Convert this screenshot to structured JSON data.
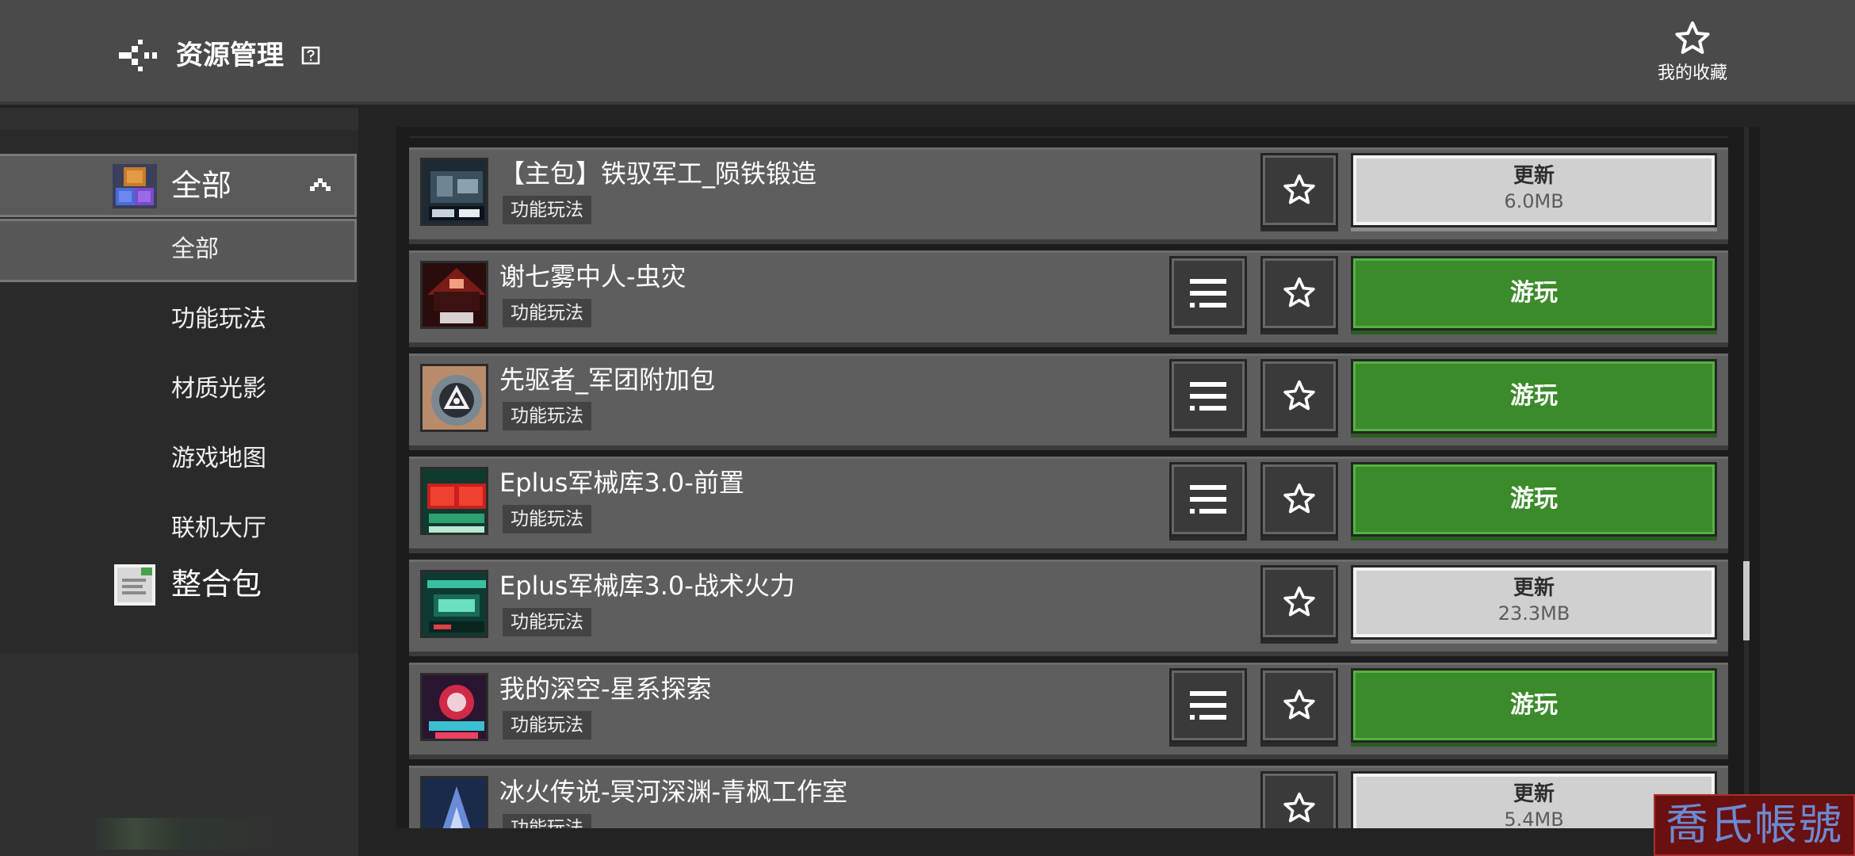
{
  "header": {
    "title": "资源管理",
    "help_icon": "help-icon",
    "back_icon": "back-arrow-icon",
    "favorites_label": "我的收藏",
    "favorites_icon": "star-outline-icon"
  },
  "sidebar": {
    "category": {
      "label": "全部",
      "icon": "blocks-icon",
      "expanded": true
    },
    "sub_items": [
      {
        "label": "全部",
        "active": true
      },
      {
        "label": "功能玩法",
        "active": false
      },
      {
        "label": "材质光影",
        "active": false
      },
      {
        "label": "游戏地图",
        "active": false
      },
      {
        "label": "联机大厅",
        "active": false
      }
    ],
    "pack": {
      "label": "整合包",
      "icon": "document-icon"
    }
  },
  "items": [
    {
      "title": "【主包】铁驭军工_陨铁锻造",
      "tag": "功能玩法",
      "has_detail": false,
      "action": "update",
      "action_label": "更新",
      "size": "6.0MB"
    },
    {
      "title": "谢七雾中人-虫灾",
      "tag": "功能玩法",
      "has_detail": true,
      "action": "play",
      "action_label": "游玩",
      "size": ""
    },
    {
      "title": "先驱者_军团附加包",
      "tag": "功能玩法",
      "has_detail": true,
      "action": "play",
      "action_label": "游玩",
      "size": ""
    },
    {
      "title": "Eplus军械库3.0-前置",
      "tag": "功能玩法",
      "has_detail": true,
      "action": "play",
      "action_label": "游玩",
      "size": ""
    },
    {
      "title": "Eplus军械库3.0-战术火力",
      "tag": "功能玩法",
      "has_detail": false,
      "action": "update",
      "action_label": "更新",
      "size": "23.3MB"
    },
    {
      "title": "我的深空-星系探索",
      "tag": "功能玩法",
      "has_detail": true,
      "action": "play",
      "action_label": "游玩",
      "size": ""
    },
    {
      "title": "冰火传说-冥河深渊-青枫工作室",
      "tag": "功能玩法",
      "has_detail": false,
      "action": "update",
      "action_label": "更新",
      "size": "5.4MB"
    }
  ],
  "watermark": "喬氏帳號",
  "colors": {
    "play_green": "#3b8b2a",
    "update_gray": "#d0d0d0",
    "row_bg": "#5e5e5e",
    "topbar_bg": "#4a4a4b"
  }
}
